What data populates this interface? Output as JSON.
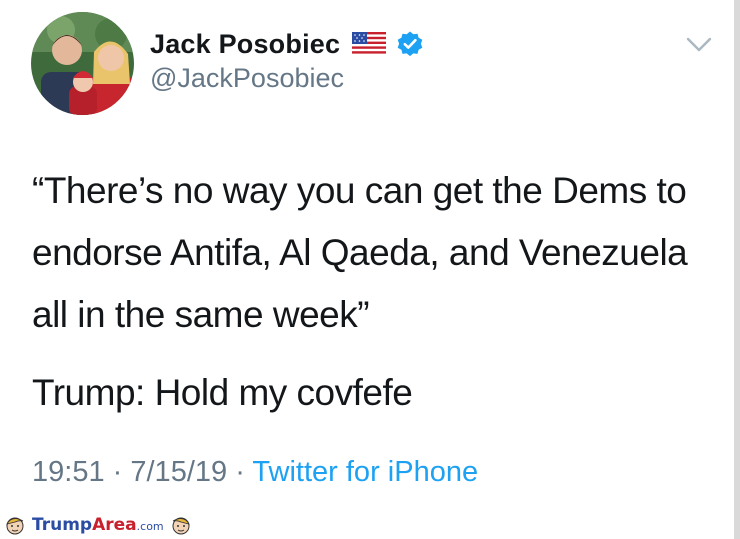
{
  "tweet": {
    "display_name": "Jack Posobiec",
    "flag_icon": "us-flag-icon",
    "verified_icon": "verified-badge-icon",
    "handle": "@JackPosobiec",
    "quote_text": "“There’s no way you can get the Dems to endorse Antifa, Al Qaeda, and Venezuela all in the same week”",
    "punchline": "Trump: Hold my covfefe",
    "time": "19:51",
    "separator": "·",
    "date": "7/15/19",
    "source": "Twitter for iPhone",
    "menu_icon": "chevron-down-icon"
  },
  "watermark": {
    "brand_part1": "Trump",
    "brand_part2": "Area",
    "suffix": ".com"
  },
  "colors": {
    "text": "#14171a",
    "secondary": "#657786",
    "link": "#1da1f2",
    "verified": "#1da1f2"
  }
}
